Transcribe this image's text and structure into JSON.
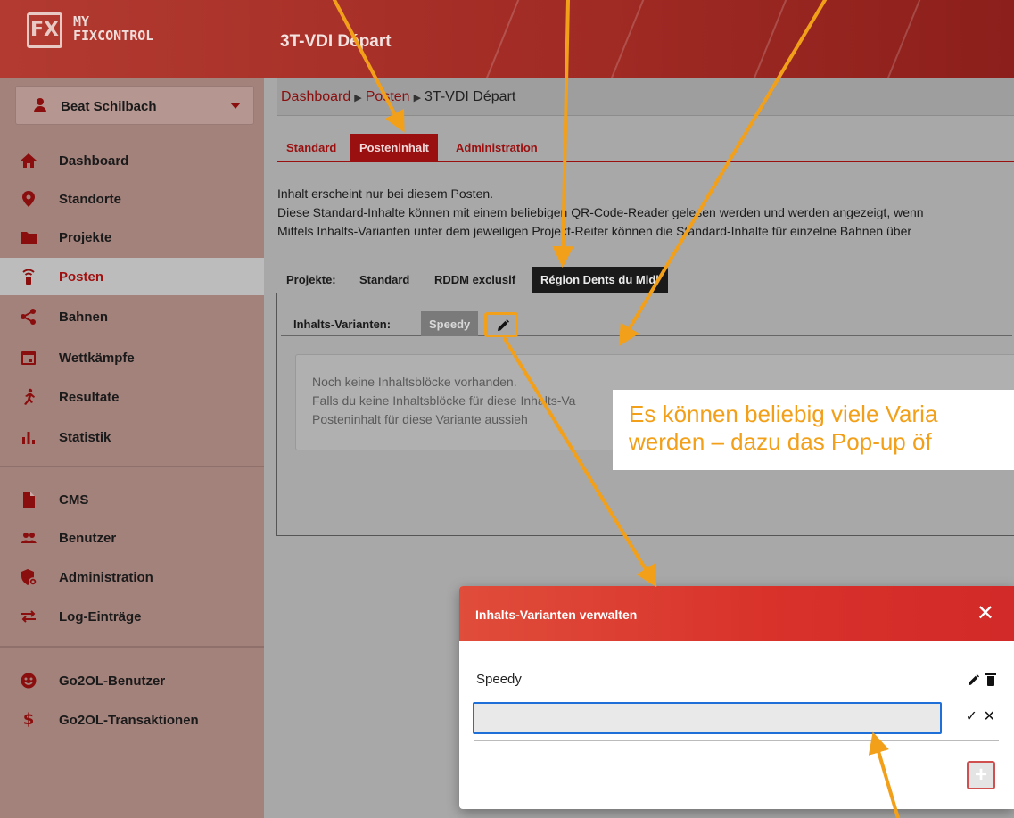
{
  "header": {
    "logo_mark": "FX",
    "logo_line1": "MY",
    "logo_line2": "FIXCONTROL",
    "page_title": "3T-VDI Départ"
  },
  "sidebar": {
    "user_name": "Beat Schilbach",
    "items": [
      {
        "label": "Dashboard",
        "icon": "home-icon"
      },
      {
        "label": "Standorte",
        "icon": "map-pin-icon"
      },
      {
        "label": "Projekte",
        "icon": "folder-icon"
      },
      {
        "label": "Posten",
        "icon": "beacon-icon"
      },
      {
        "label": "Bahnen",
        "icon": "share-icon"
      },
      {
        "label": "Wettkämpfe",
        "icon": "calendar-icon"
      },
      {
        "label": "Resultate",
        "icon": "runner-icon"
      },
      {
        "label": "Statistik",
        "icon": "bar-chart-icon"
      },
      {
        "label": "CMS",
        "icon": "document-icon"
      },
      {
        "label": "Benutzer",
        "icon": "users-icon"
      },
      {
        "label": "Administration",
        "icon": "shield-gear-icon"
      },
      {
        "label": "Log-Einträge",
        "icon": "arrows-icon"
      },
      {
        "label": "Go2OL-Benutzer",
        "icon": "smiley-icon"
      },
      {
        "label": "Go2OL-Transaktionen",
        "icon": "dollar-icon"
      }
    ],
    "active": "Posten"
  },
  "breadcrumb": {
    "link1": "Dashboard",
    "link2": "Posten",
    "current": "3T-VDI Départ"
  },
  "tabs": [
    "Standard",
    "Posteninhalt",
    "Administration"
  ],
  "active_tab": "Posteninhalt",
  "info": {
    "line1": "Inhalt erscheint nur bei diesem Posten.",
    "line2": "Diese Standard-Inhalte können mit einem beliebigen QR-Code-Reader gelesen werden und werden angezeigt, wenn",
    "line3": "Mittels Inhalts-Varianten unter dem jeweiligen Projekt-Reiter können die Standard-Inhalte für einzelne Bahnen über"
  },
  "projects": {
    "label": "Projekte:",
    "tabs": [
      "Standard",
      "RDDM exclusif",
      "Région Dents du Midi"
    ],
    "active": "Région Dents du Midi"
  },
  "variants": {
    "label": "Inhalts-Varianten:",
    "chip": "Speedy"
  },
  "empty_state": {
    "line1": "Noch keine Inhaltsblöcke vorhanden.",
    "line2": "Falls du keine Inhaltsblöcke für diese Inhalts-Va",
    "line3": "Posteninhalt für diese Variante aussieh"
  },
  "callout": {
    "line1": "Es können beliebig viele Varia",
    "line2": "werden – dazu das Pop-up öf"
  },
  "modal": {
    "title": "Inhalts-Varianten verwalten",
    "close": "✕",
    "row_text": "Speedy",
    "input_value": "",
    "check": "✓",
    "cancel": "✕",
    "add": "+"
  },
  "colors": {
    "brand_red": "#9a0f0f",
    "annotation_orange": "#f2a01a",
    "input_focus": "#1e6fd8"
  }
}
